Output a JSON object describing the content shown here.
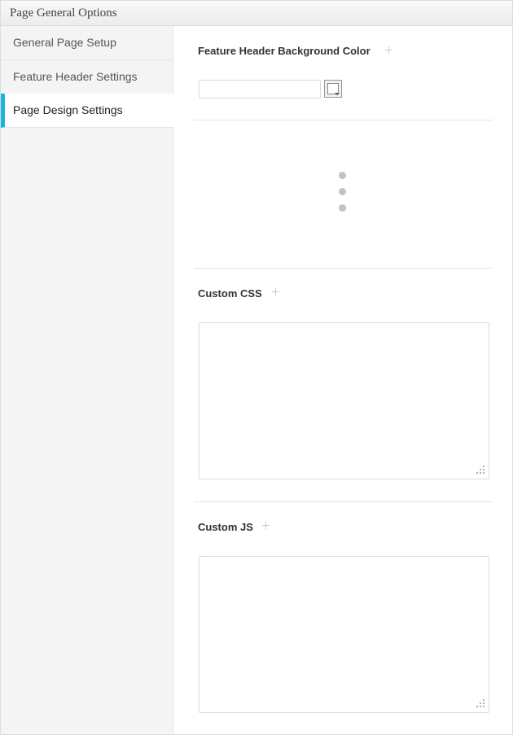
{
  "panel": {
    "title": "Page General Options"
  },
  "sidebar": {
    "items": [
      {
        "label": "General Page Setup"
      },
      {
        "label": "Feature Header Settings"
      },
      {
        "label": "Page Design Settings"
      }
    ]
  },
  "options": {
    "feature_bg": {
      "label": "Feature Header Background Color",
      "value": "",
      "placeholder": ""
    },
    "custom_css": {
      "label": "Custom CSS",
      "value": ""
    },
    "custom_js": {
      "label": "Custom JS",
      "value": ""
    }
  },
  "icons": {
    "add": "plus-icon",
    "more": "vertical-ellipsis-icon",
    "picker": "color-swatch-icon",
    "resize": "resize-grip-icon"
  },
  "colors": {
    "accent": "#1ab4e0",
    "sidebar_bg": "#f5f5f5",
    "active_tab_bg": "#ffffff"
  }
}
